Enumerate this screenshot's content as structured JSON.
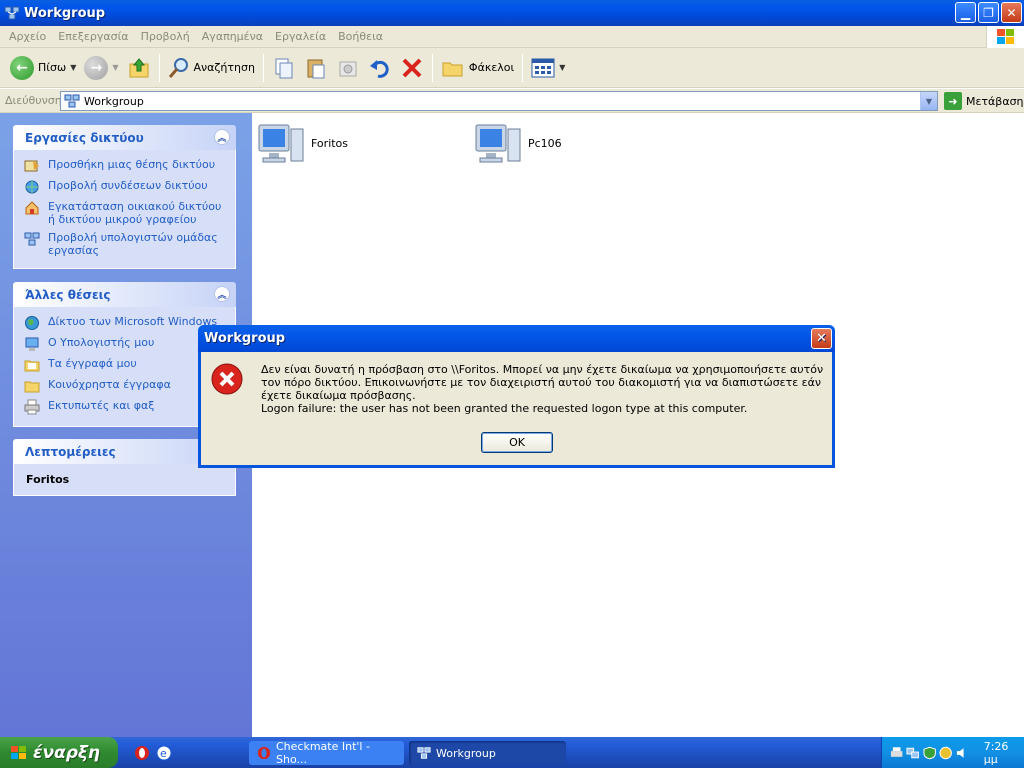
{
  "window": {
    "title": "Workgroup",
    "buttons": [
      "minimize",
      "restore",
      "close"
    ]
  },
  "menu": [
    "Αρχείο",
    "Επεξεργασία",
    "Προβολή",
    "Αγαπημένα",
    "Εργαλεία",
    "Βοήθεια"
  ],
  "toolbar": {
    "back_label": "Πίσω",
    "search_label": "Αναζήτηση",
    "folders_label": "Φάκελοι"
  },
  "address": {
    "label": "Διεύθυνση",
    "value": "Workgroup",
    "go_label": "Μετάβαση"
  },
  "network_tasks": {
    "title": "Εργασίες δικτύου",
    "items": [
      {
        "label": "Προσθήκη μιας θέσης δικτύου",
        "icon": "add-network-place-icon"
      },
      {
        "label": "Προβολή συνδέσεων δικτύου",
        "icon": "network-connections-icon"
      },
      {
        "label": "Εγκατάσταση οικιακού δικτύου ή δικτύου μικρού γραφείου",
        "icon": "home-network-icon"
      },
      {
        "label": "Προβολή υπολογιστών ομάδας εργασίας",
        "icon": "workgroup-computers-icon"
      }
    ]
  },
  "other_places": {
    "title": "Άλλες θέσεις",
    "items": [
      {
        "label": "Δίκτυο των Microsoft Windows",
        "icon": "network-globe-icon"
      },
      {
        "label": "Ο Υπολογιστής μου",
        "icon": "my-computer-icon"
      },
      {
        "label": "Τα έγγραφά μου",
        "icon": "my-documents-icon"
      },
      {
        "label": "Κοινόχρηστα έγγραφα",
        "icon": "shared-folder-icon"
      },
      {
        "label": "Εκτυπωτές και φαξ",
        "icon": "printer-icon"
      }
    ]
  },
  "details": {
    "title": "Λεπτομέρειες",
    "value": "Foritos"
  },
  "computers": [
    {
      "label": "Foritos"
    },
    {
      "label": "Pc106"
    }
  ],
  "dialog": {
    "title": "Workgroup",
    "message": "Δεν είναι δυνατή η πρόσβαση στο \\\\Foritos. Μπορεί να μην έχετε δικαίωμα να χρησιμοποιήσετε αυτόν τον πόρο δικτύου. Επικοινωνήστε με τον διαχειριστή αυτού του διακομιστή για να διαπιστώσετε εάν έχετε δικαίωμα πρόσβασης.",
    "detail": "Logon failure: the user has not been granted the requested logon type at this computer.",
    "ok_label": "OK"
  },
  "taskbar": {
    "start_label": "έναρξη",
    "tasks": [
      {
        "label": "Checkmate Int'l - Sho..."
      },
      {
        "label": "Workgroup"
      }
    ],
    "clock": "7:26 μμ"
  }
}
